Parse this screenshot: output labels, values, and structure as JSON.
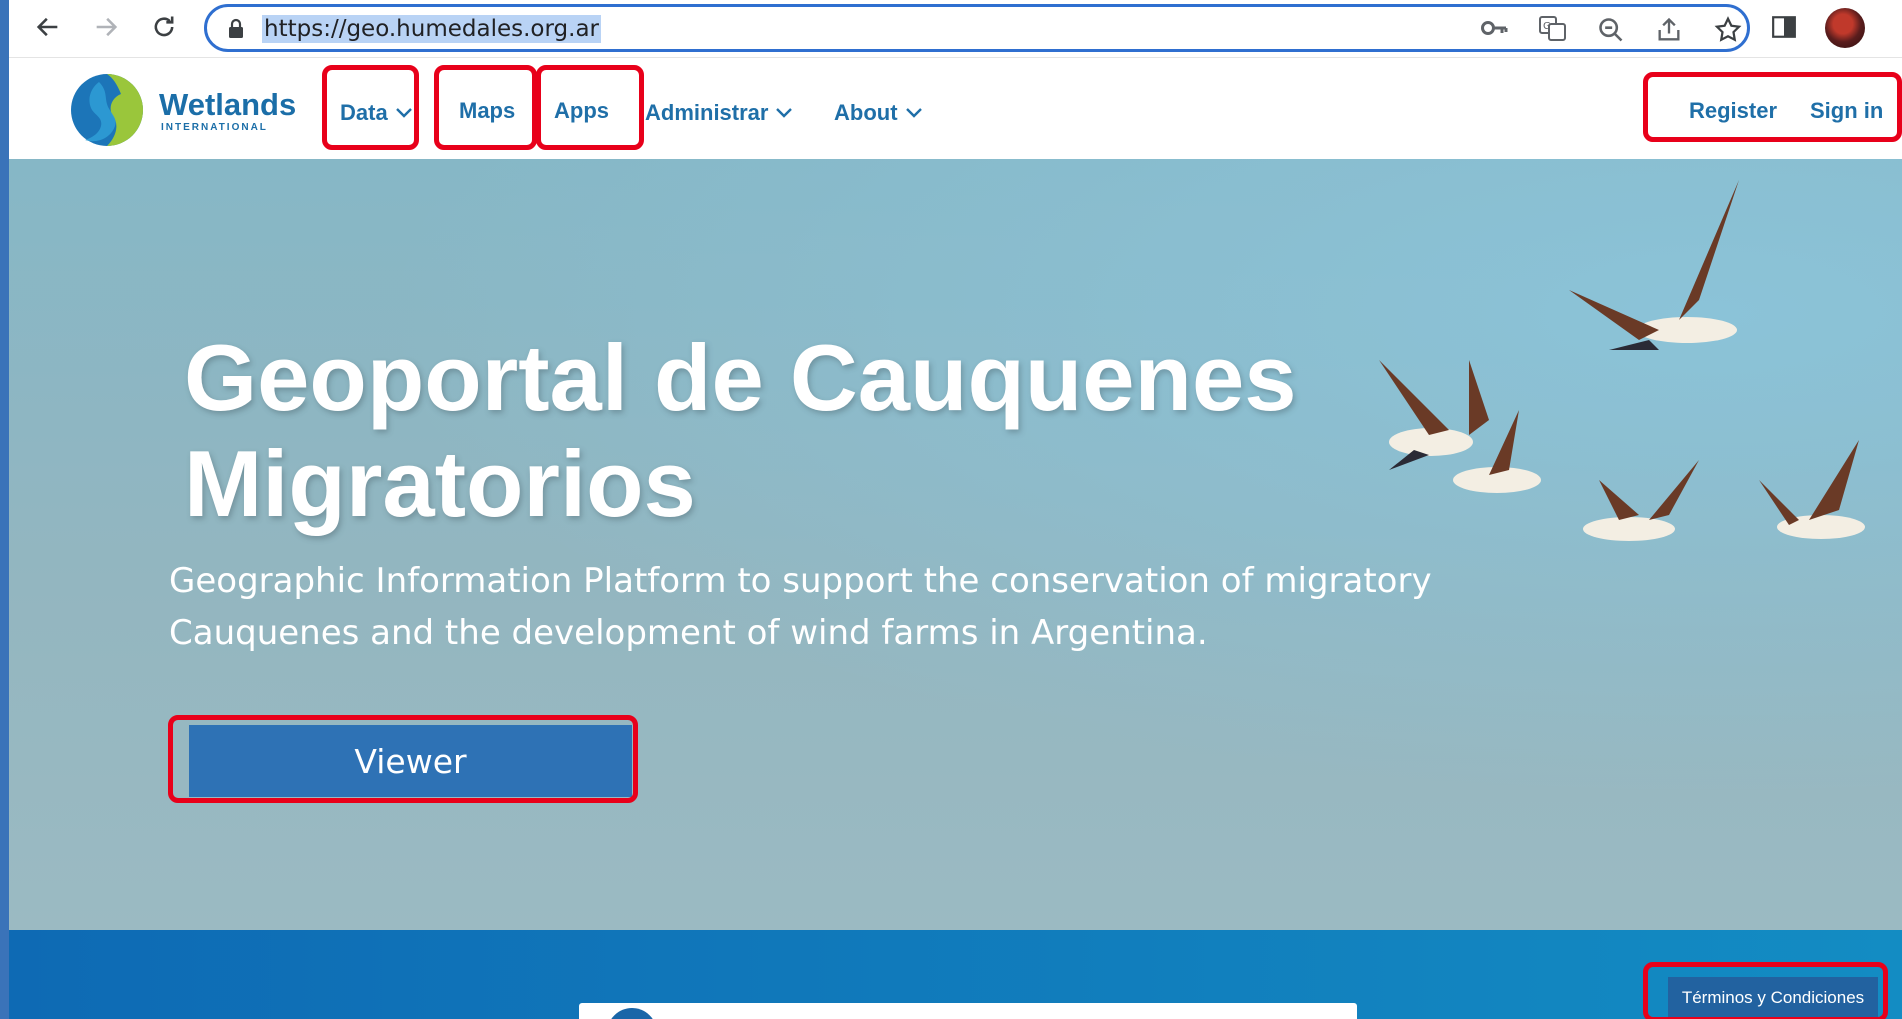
{
  "browser": {
    "url": "https://geo.humedales.org.ar",
    "icons": [
      "back-arrow-icon",
      "forward-arrow-icon",
      "reload-icon",
      "lock-icon",
      "key-icon",
      "translate-icon",
      "zoom-out-icon",
      "share-icon",
      "star-icon",
      "side-panel-icon",
      "profile-avatar"
    ]
  },
  "header": {
    "logo_name": "Wetlands",
    "logo_tagline": "INTERNATIONAL",
    "nav": [
      {
        "label": "Data",
        "dropdown": true
      },
      {
        "label": "Maps",
        "dropdown": false
      },
      {
        "label": "Apps",
        "dropdown": false
      },
      {
        "label": "Administrar",
        "dropdown": true
      },
      {
        "label": "About",
        "dropdown": true
      }
    ],
    "register_label": "Register",
    "signin_label": "Sign in"
  },
  "hero": {
    "title": "Geoportal de Cauquenes Migratorios",
    "subtitle": "Geographic Information Platform to support the conservation of migratory Cauquenes and the development of wind farms in Argentina.",
    "viewer_label": "Viewer"
  },
  "footer": {
    "terms_label": "Términos y Condiciones"
  },
  "colors": {
    "highlight_box": "#e8001a",
    "nav_text": "#1f6fa8",
    "button_blue": "#2e72b5",
    "band_blue": "#0e6ab4"
  }
}
